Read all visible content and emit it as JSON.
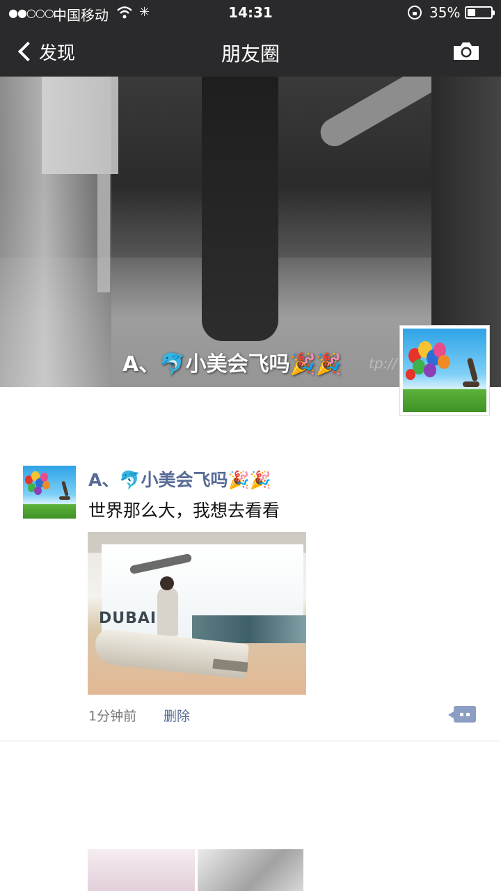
{
  "status_bar": {
    "signal": "●●○○○",
    "carrier": "中国移动",
    "time": "14:31",
    "battery_percent": "35%",
    "battery_level": 0.35
  },
  "nav": {
    "back_label": "发现",
    "title": "朋友圈"
  },
  "cover": {
    "name": "A、🐬小美会飞吗🎉🎉",
    "watermark": "tp://"
  },
  "post": {
    "author": "A、🐬小美会飞吗🎉🎉",
    "text": "世界那么大，我想去看看",
    "time": "1分钟前",
    "delete_label": "删除",
    "photo_sign": "DUBAI"
  },
  "colors": {
    "link": "#576b95",
    "topbar": "#2a2a2c"
  }
}
